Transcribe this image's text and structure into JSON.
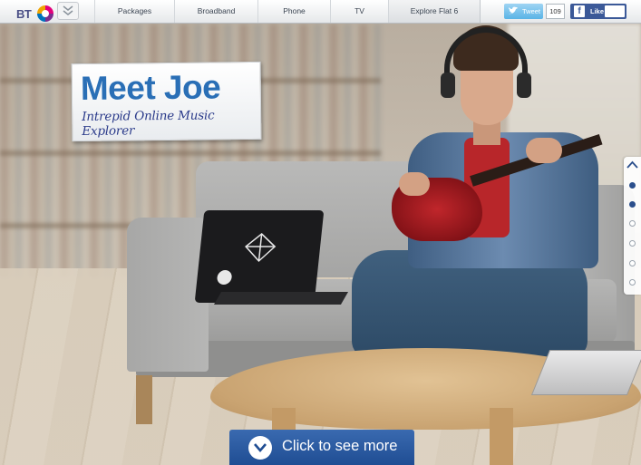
{
  "header": {
    "logo_text": "BT",
    "nav_tabs": [
      {
        "label": "Packages"
      },
      {
        "label": "Broadband"
      },
      {
        "label": "Phone"
      },
      {
        "label": "TV"
      },
      {
        "label": "Explore Flat 6"
      }
    ],
    "active_tab": "Explore Flat 6",
    "tweet_label": "Tweet",
    "tweet_count": "109",
    "like_label": "Like"
  },
  "hero": {
    "title": "Meet Joe",
    "subtitle": "Intrepid Online Music Explorer"
  },
  "pagination": {
    "dots": [
      "active",
      "active",
      "inactive",
      "inactive",
      "inactive",
      "inactive"
    ]
  },
  "cta": {
    "label": "Click to see more"
  },
  "colors": {
    "brand_blue": "#2a6fb6",
    "cta_blue": "#1f4d93",
    "facebook_blue": "#3b5998",
    "twitter_blue": "#5ab4e6"
  }
}
